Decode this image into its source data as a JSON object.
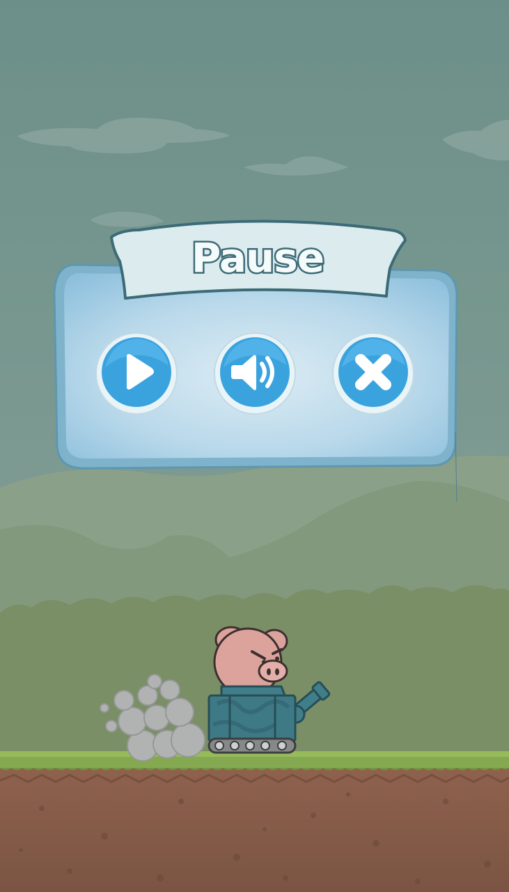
{
  "pause_dialog": {
    "title": "Pause",
    "buttons": [
      {
        "id": "resume",
        "icon": "play-icon"
      },
      {
        "id": "sound",
        "icon": "speaker-icon"
      },
      {
        "id": "quit",
        "icon": "close-icon"
      }
    ]
  },
  "colors": {
    "sky_top": "#6e918c",
    "sky_bottom": "#8aa49d",
    "panel_fill": "#a9cfe6",
    "panel_border": "#6aa1b8",
    "button_blue": "#3aa3de",
    "banner_fill": "#dcebed",
    "title_outline": "#3c6b78",
    "grass": "#7fa54b",
    "dirt": "#8e5d45"
  }
}
